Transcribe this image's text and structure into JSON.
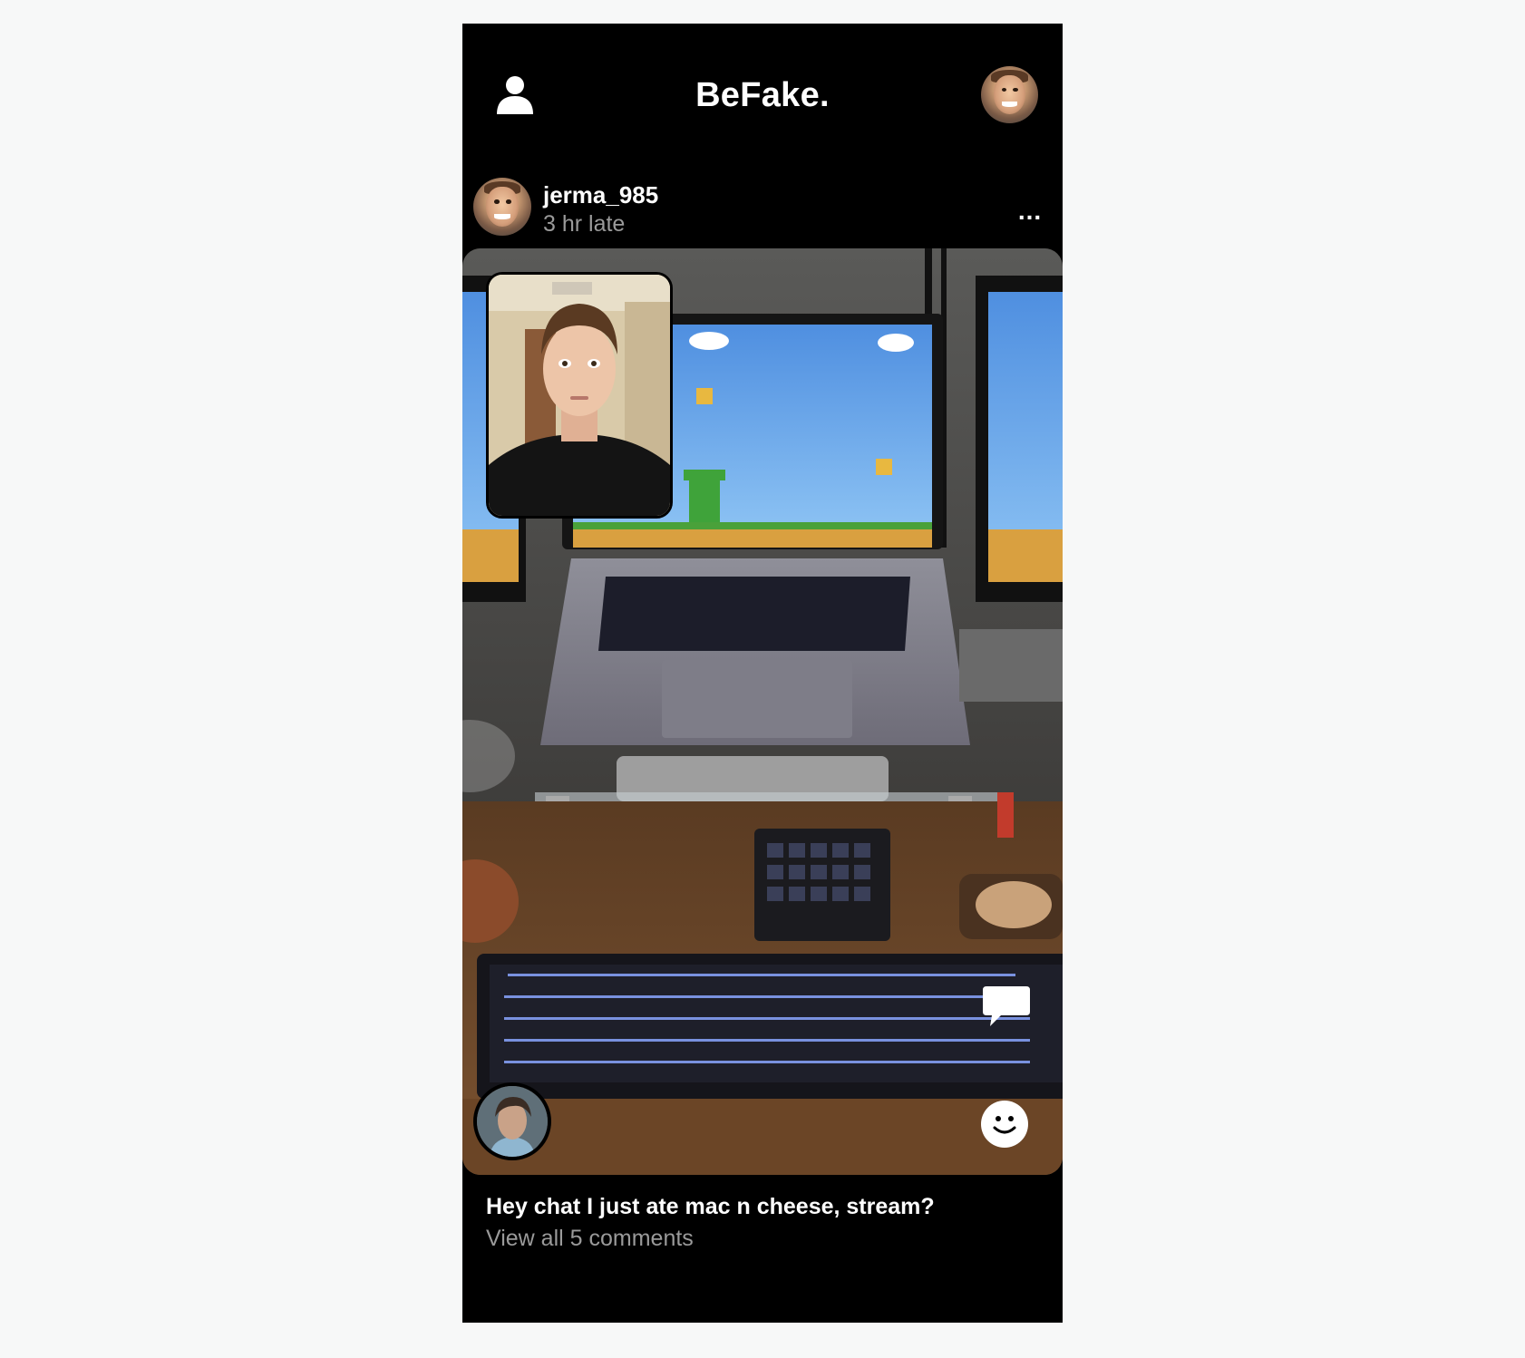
{
  "app": {
    "title": "BeFake."
  },
  "header": {
    "profile_icon": "person-icon",
    "me_avatar": "user-avatar"
  },
  "post": {
    "username": "jerma_985",
    "late_label": "3 hr late",
    "more_label": "...",
    "caption": "Hey chat I just ate mac n cheese, stream?",
    "comments_link": "View all 5 comments"
  },
  "icons": {
    "comment": "speech-bubble-icon",
    "reaction": "smiley-icon",
    "more": "ellipsis-icon"
  },
  "colors": {
    "background": "#000000",
    "page": "#f7f8f8",
    "text": "#ffffff",
    "muted": "#9a9a9a"
  }
}
